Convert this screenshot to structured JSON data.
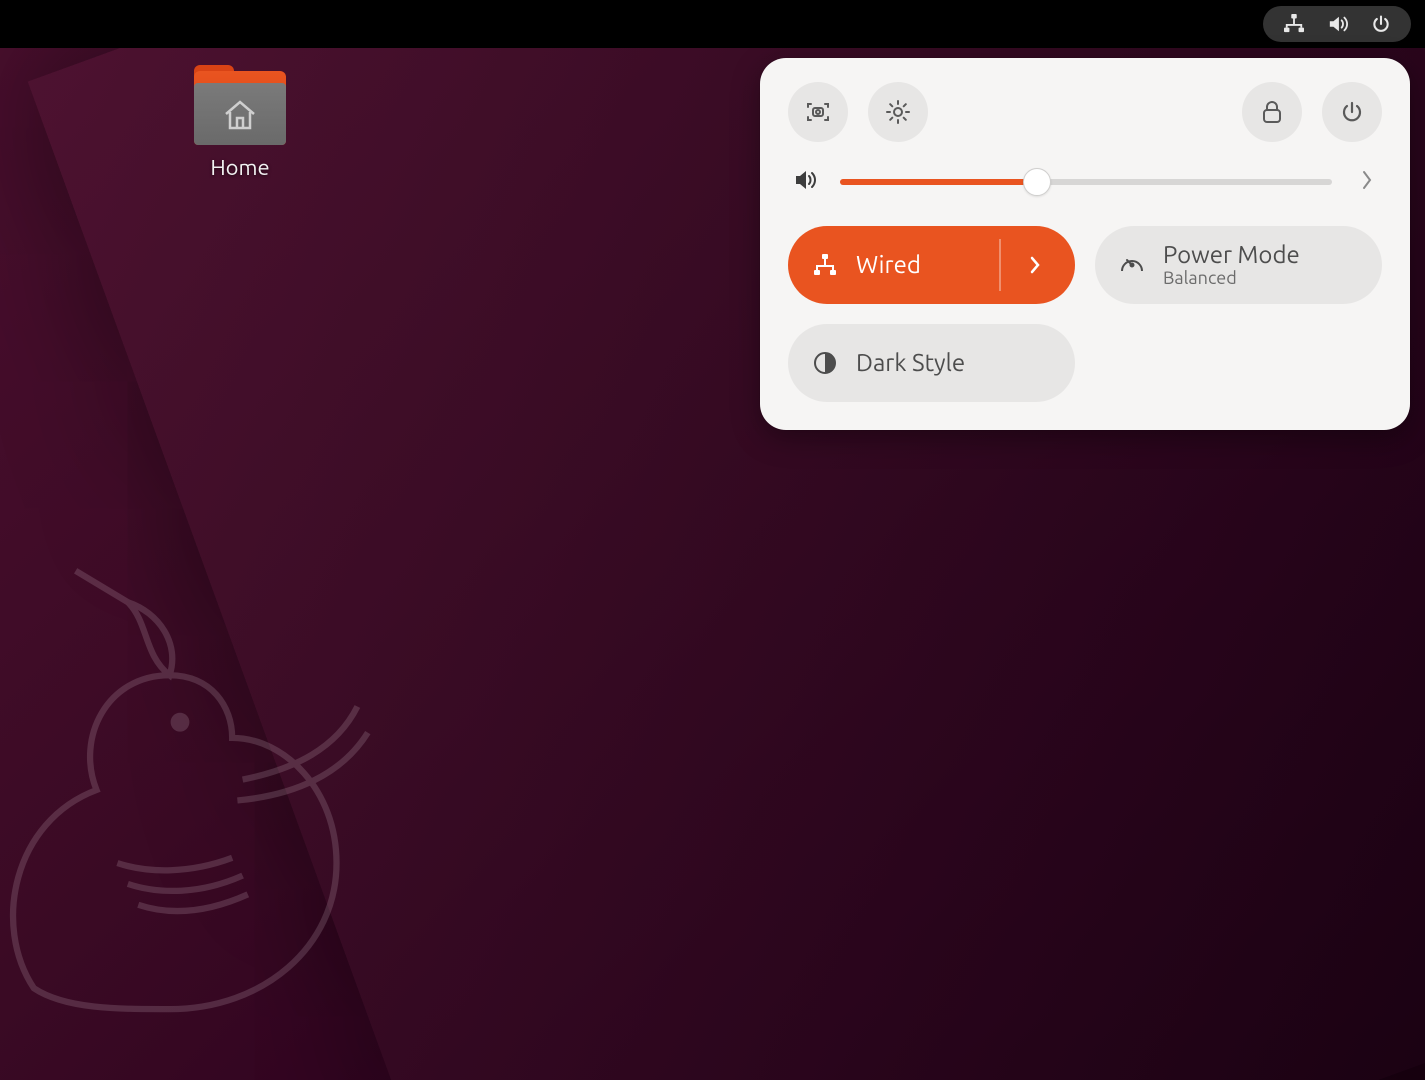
{
  "desktop": {
    "home_label": "Home"
  },
  "panel": {
    "volume_percent": 40,
    "wired_label": "Wired",
    "power_mode_label": "Power Mode",
    "power_mode_value": "Balanced",
    "dark_style_label": "Dark Style"
  },
  "colors": {
    "accent": "#e95420",
    "panel_bg": "#f6f5f4",
    "pill_inactive": "#e7e6e5"
  }
}
